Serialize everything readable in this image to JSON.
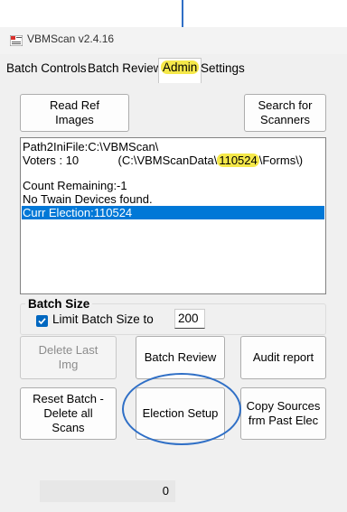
{
  "window": {
    "title": "VBMScan v2.4.16",
    "icon": "vbmscan-app-icon"
  },
  "tabs": [
    {
      "label": "Batch Controls",
      "active": false
    },
    {
      "label": "Batch Review",
      "active": false
    },
    {
      "label": "Admin",
      "active": true,
      "highlighted": true
    },
    {
      "label": "Settings",
      "active": false
    }
  ],
  "buttons": {
    "read_ref_images": "Read Ref\nImages",
    "search_scanners": "Search for\nScanners",
    "delete_last_img": "Delete Last\nImg",
    "batch_review": "Batch Review",
    "audit_report": "Audit report",
    "reset_batch": "Reset Batch -\nDelete all\nScans",
    "election_setup": "Election Setup",
    "copy_sources": "Copy Sources\nfrm Past Elec"
  },
  "log": {
    "path": "Path2IniFile:C:\\VBMScan\\",
    "voters_prefix": "Voters : 10",
    "voters_path_start": "(C:\\VBMScanData\\",
    "voters_path_highlight": "110524",
    "voters_path_end": "\\Forms\\)",
    "count_remaining": "Count Remaining:-1",
    "twain": "No Twain Devices found.",
    "curr_election": "Curr Election:110524"
  },
  "batch_size": {
    "group_title": "Batch Size",
    "limit_label": "Limit Batch Size to",
    "limit_checked": true,
    "value": "200"
  },
  "status": {
    "count": "0"
  },
  "colors": {
    "annotation": "#2f6fc6",
    "highlight": "#f5e84a",
    "selection": "#0078d7",
    "checkbox": "#0067c0"
  }
}
